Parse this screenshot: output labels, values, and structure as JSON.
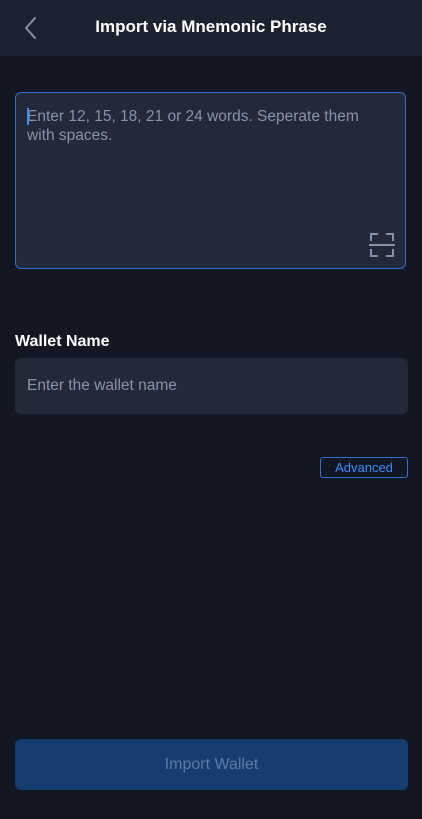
{
  "header": {
    "title": "Import via Mnemonic Phrase",
    "back_icon": "chevron-left-icon"
  },
  "mnemonic": {
    "placeholder": "Enter 12, 15, 18, 21 or 24 words. Seperate them with spaces.",
    "value": "",
    "scan_icon": "scan-icon"
  },
  "wallet_name": {
    "label": "Wallet Name",
    "placeholder": "Enter the wallet name",
    "value": ""
  },
  "advanced": {
    "label": "Advanced"
  },
  "import_button": {
    "label": "Import Wallet",
    "enabled": false
  },
  "colors": {
    "background": "#121723",
    "header_bg": "#1c2230",
    "field_bg": "#222a3a",
    "accent": "#2f6fd0",
    "button_disabled_bg": "#163d70",
    "button_disabled_text": "#5b7aa6"
  }
}
